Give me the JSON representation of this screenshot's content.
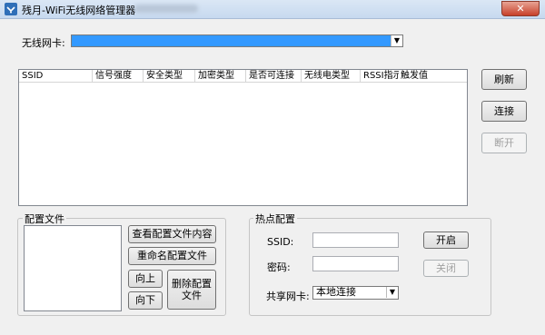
{
  "window": {
    "title": "残月-WiFi无线网络管理器",
    "close_glyph": "✕"
  },
  "adapter": {
    "label": "无线网卡:",
    "arrow_glyph": "▼"
  },
  "networks": {
    "columns": [
      "SSID",
      "信号强度",
      "安全类型",
      "加密类型",
      "是否可连接",
      "无线电类型",
      "RSSI指示",
      "触发值"
    ]
  },
  "actions": {
    "refresh": "刷新",
    "connect": "连接",
    "disconnect": "断开"
  },
  "profiles": {
    "group_title": "配置文件",
    "view": "查看配置文件内容",
    "rename": "重命名配置文件",
    "up": "向上",
    "down": "向下",
    "delete": "删除配置文件"
  },
  "hotspot": {
    "group_title": "热点配置",
    "ssid_label": "SSID:",
    "password_label": "密码:",
    "share_label": "共享网卡:",
    "share_value": "本地连接",
    "start": "开启",
    "stop": "关闭",
    "arrow_glyph": "▼"
  }
}
